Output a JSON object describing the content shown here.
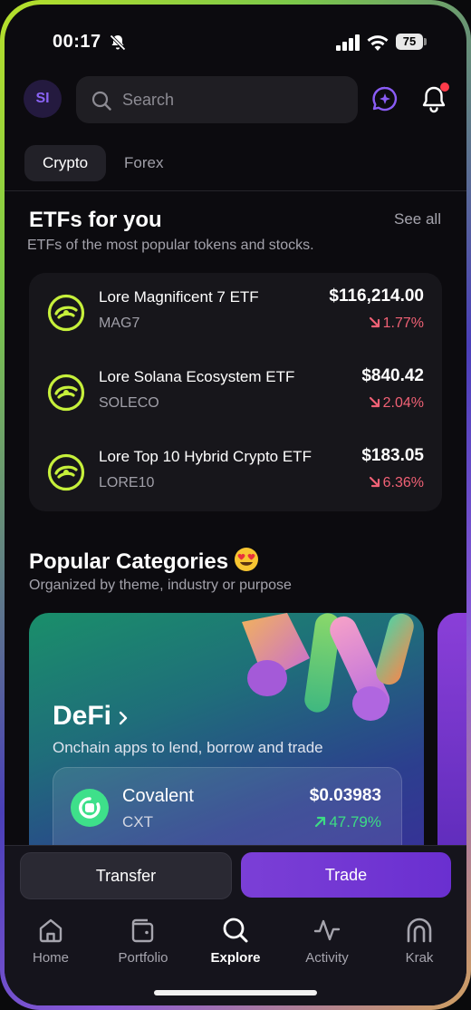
{
  "status_bar": {
    "time": "00:17",
    "battery": "75"
  },
  "header": {
    "avatar_initials": "SI",
    "search_placeholder": "Search"
  },
  "tabs": [
    {
      "label": "Crypto",
      "active": true
    },
    {
      "label": "Forex",
      "active": false
    }
  ],
  "etfs": {
    "title": "ETFs for you",
    "see_all": "See all",
    "subtitle": "ETFs of the most popular tokens and stocks.",
    "items": [
      {
        "name": "Lore Magnificent 7 ETF",
        "ticker": "MAG7",
        "price": "$116,214.00",
        "change": "1.77%",
        "direction": "down"
      },
      {
        "name": "Lore Solana Ecosystem ETF",
        "ticker": "SOLECO",
        "price": "$840.42",
        "change": "2.04%",
        "direction": "down"
      },
      {
        "name": "Lore Top 10 Hybrid Crypto ETF",
        "ticker": "LORE10",
        "price": "$183.05",
        "change": "6.36%",
        "direction": "down"
      }
    ]
  },
  "categories": {
    "title": "Popular Categories",
    "subtitle": "Organized by theme, industry or purpose",
    "cards": [
      {
        "label": "DeFi",
        "description": "Onchain apps to lend, borrow and trade",
        "asset": {
          "name": "Covalent",
          "ticker": "CXT",
          "price": "$0.03983",
          "change": "47.79%",
          "direction": "up"
        }
      }
    ]
  },
  "actions": {
    "transfer": "Transfer",
    "trade": "Trade"
  },
  "nav": [
    {
      "label": "Home",
      "icon": "home-icon"
    },
    {
      "label": "Portfolio",
      "icon": "wallet-icon"
    },
    {
      "label": "Explore",
      "icon": "search-icon",
      "active": true
    },
    {
      "label": "Activity",
      "icon": "activity-icon"
    },
    {
      "label": "Krak",
      "icon": "krak-icon"
    }
  ],
  "colors": {
    "accent": "#7b3fd6",
    "negative": "#f06175",
    "positive": "#3ddc84",
    "etf_logo": "#c6f03b"
  }
}
